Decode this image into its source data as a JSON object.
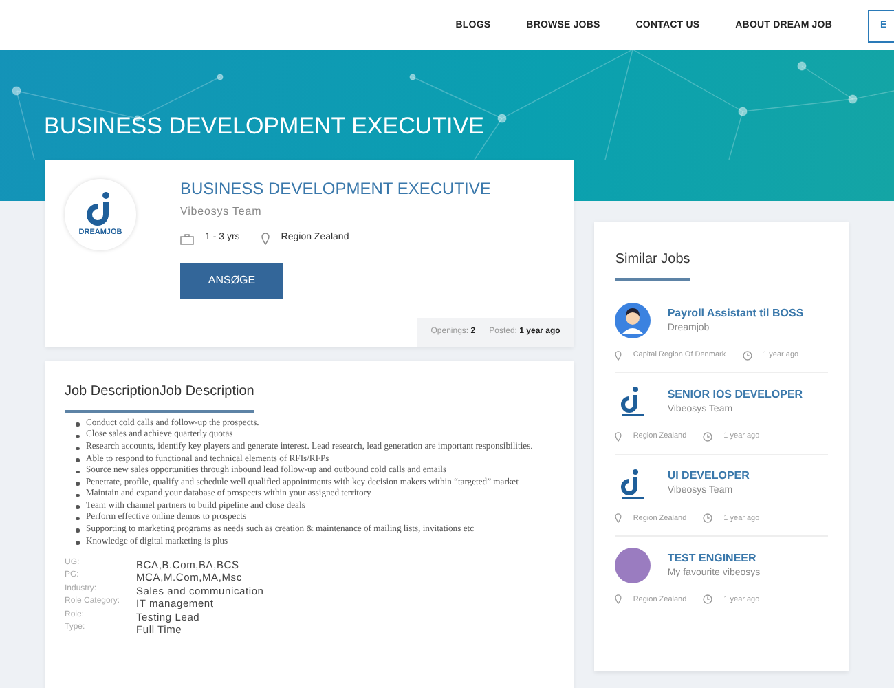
{
  "nav": {
    "links": [
      {
        "label": "BLOGS"
      },
      {
        "label": "BROWSE JOBS"
      },
      {
        "label": "CONTACT US"
      },
      {
        "label": "ABOUT DREAM JOB"
      }
    ],
    "button": "E"
  },
  "hero": {
    "title": "BUSINESS DEVELOPMENT EXECUTIVE"
  },
  "job": {
    "logo_text": "DREAMJOB",
    "title": "BUSINESS DEVELOPMENT EXECUTIVE",
    "company": "Vibeosys Team",
    "experience": "1 - 3 yrs",
    "location": "Region Zealand",
    "apply": "ANSØGE",
    "openings_label": "Openings:",
    "openings": "2",
    "posted_label": "Posted:",
    "posted": "1 year ago"
  },
  "description": {
    "heading": "Job DescriptionJob Description",
    "bullets": [
      "Conduct cold calls and follow-up the prospects.",
      "Close sales and achieve quarterly quotas",
      "Research accounts, identify key players and generate interest. Lead research, lead generation are important responsibilities.",
      "Able to respond to functional and technical elements of RFIs/RFPs",
      "Source new sales opportunities through inbound lead follow-up and outbound cold calls and emails",
      "Penetrate, profile, qualify and schedule well qualified appointments with key decision makers within “targeted” market",
      "Maintain and expand your database of prospects within your assigned territory",
      "Team with channel partners to build pipeline and close deals",
      "Perform effective online demos to prospects",
      "Supporting to marketing programs as needs such as creation & maintenance of mailing lists, invitations etc",
      "Knowledge of digital marketing is plus"
    ],
    "details": [
      {
        "label": "UG:",
        "value": "BCA,B.Com,BA,BCS"
      },
      {
        "label": "PG:",
        "value": "MCA,M.Com,MA,Msc"
      },
      {
        "label": "Industry:",
        "value": "Sales and communication"
      },
      {
        "label": "Role Category:",
        "value": "IT management"
      },
      {
        "label": "Role:",
        "value": "Testing Lead"
      },
      {
        "label": "Type:",
        "value": "Full Time"
      }
    ]
  },
  "similar_jobs": {
    "heading": "Similar Jobs",
    "items": [
      {
        "kind": "avatar",
        "title": "Payroll Assistant til BOSS",
        "company": "Dreamjob",
        "location": "Capital Region Of Denmark",
        "posted": "1 year ago"
      },
      {
        "kind": "logo",
        "title": "SENIOR IOS DEVELOPER",
        "company": "Vibeosys Team",
        "location": "Region Zealand",
        "posted": "1 year ago"
      },
      {
        "kind": "logo",
        "title": "UI DEVELOPER",
        "company": "Vibeosys Team",
        "location": "Region Zealand",
        "posted": "1 year ago"
      },
      {
        "kind": "photo",
        "title": "TEST ENGINEER",
        "company": "My favourite vibeosys",
        "location": "Region Zealand",
        "posted": "1 year ago"
      }
    ]
  }
}
